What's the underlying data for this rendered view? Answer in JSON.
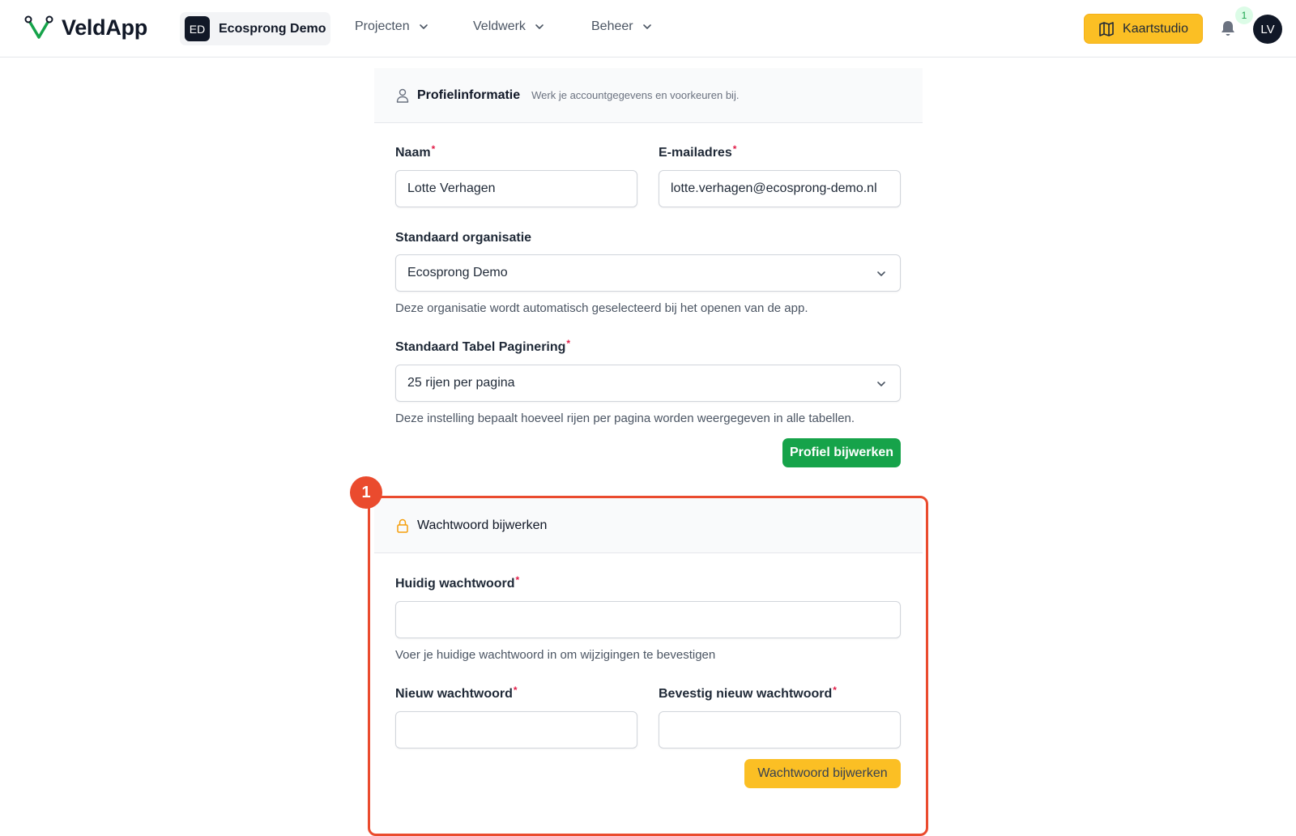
{
  "topbar": {
    "app_name": "VeldApp",
    "org_badge": "ED",
    "org_name": "Ecosprong Demo",
    "nav": [
      "Projecten",
      "Veldwerk",
      "Beheer"
    ],
    "kaartstudio_label": "Kaartstudio",
    "notification_count": "1",
    "avatar_initials": "LV",
    "accent_color": "#fbbf24",
    "brand_color": "#16a34a"
  },
  "profile": {
    "title": "Profielinformatie",
    "subtitle": "Werk je accountgegevens en voorkeuren bij.",
    "name_label": "Naam",
    "name_value": "Lotte Verhagen",
    "email_label": "E-mailadres",
    "email_value": "lotte.verhagen@ecosprong-demo.nl",
    "org_label": "Standaard organisatie",
    "org_value": "Ecosprong Demo",
    "org_help": "Deze organisatie wordt automatisch geselecteerd bij het openen van de app.",
    "pagination_label": "Standaard Tabel Paginering",
    "pagination_value": "25 rijen per pagina",
    "pagination_help": "Deze instelling bepaalt hoeveel rijen per pagina worden weergegeven in alle tabellen.",
    "submit_label": "Profiel bijwerken"
  },
  "password": {
    "step_number": "1",
    "title": "Wachtwoord bijwerken",
    "current_label": "Huidig wachtwoord",
    "current_value": "",
    "current_help": "Voer je huidige wachtwoord in om wijzigingen te bevestigen",
    "new_label": "Nieuw wachtwoord",
    "new_value": "",
    "confirm_label": "Bevestig nieuw wachtwoord",
    "confirm_value": "",
    "submit_label": "Wachtwoord bijwerken",
    "highlight_color": "#ea4b2e"
  }
}
